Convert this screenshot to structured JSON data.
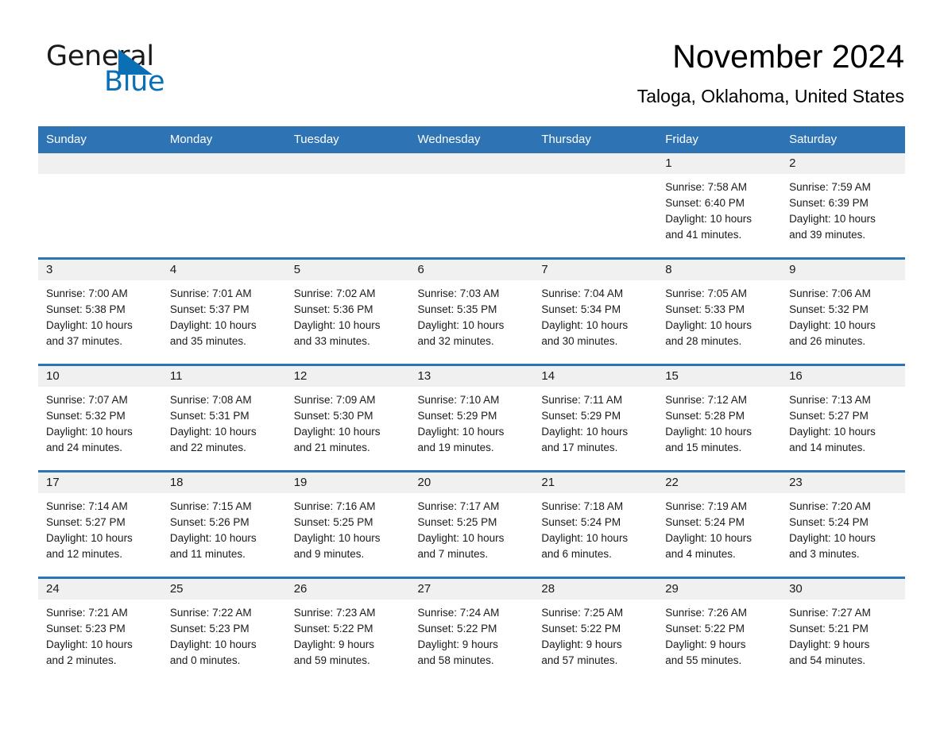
{
  "logo": {
    "word1": "General",
    "word2": "Blue",
    "triangle_color": "#0a6fb5"
  },
  "header": {
    "month_title": "November 2024",
    "location": "Taloga, Oklahoma, United States"
  },
  "theme": {
    "header_blue": "#2e74b5",
    "daynum_gray": "#f0f0f0",
    "cell_white": "#ffffff",
    "text_black": "#1a1a1a"
  },
  "calendar": {
    "weekday_headers": [
      "Sunday",
      "Monday",
      "Tuesday",
      "Wednesday",
      "Thursday",
      "Friday",
      "Saturday"
    ],
    "weeks": [
      [
        {
          "day": "",
          "lines": []
        },
        {
          "day": "",
          "lines": []
        },
        {
          "day": "",
          "lines": []
        },
        {
          "day": "",
          "lines": []
        },
        {
          "day": "",
          "lines": []
        },
        {
          "day": "1",
          "lines": [
            "Sunrise: 7:58 AM",
            "Sunset: 6:40 PM",
            "Daylight: 10 hours",
            "and 41 minutes."
          ]
        },
        {
          "day": "2",
          "lines": [
            "Sunrise: 7:59 AM",
            "Sunset: 6:39 PM",
            "Daylight: 10 hours",
            "and 39 minutes."
          ]
        }
      ],
      [
        {
          "day": "3",
          "lines": [
            "Sunrise: 7:00 AM",
            "Sunset: 5:38 PM",
            "Daylight: 10 hours",
            "and 37 minutes."
          ]
        },
        {
          "day": "4",
          "lines": [
            "Sunrise: 7:01 AM",
            "Sunset: 5:37 PM",
            "Daylight: 10 hours",
            "and 35 minutes."
          ]
        },
        {
          "day": "5",
          "lines": [
            "Sunrise: 7:02 AM",
            "Sunset: 5:36 PM",
            "Daylight: 10 hours",
            "and 33 minutes."
          ]
        },
        {
          "day": "6",
          "lines": [
            "Sunrise: 7:03 AM",
            "Sunset: 5:35 PM",
            "Daylight: 10 hours",
            "and 32 minutes."
          ]
        },
        {
          "day": "7",
          "lines": [
            "Sunrise: 7:04 AM",
            "Sunset: 5:34 PM",
            "Daylight: 10 hours",
            "and 30 minutes."
          ]
        },
        {
          "day": "8",
          "lines": [
            "Sunrise: 7:05 AM",
            "Sunset: 5:33 PM",
            "Daylight: 10 hours",
            "and 28 minutes."
          ]
        },
        {
          "day": "9",
          "lines": [
            "Sunrise: 7:06 AM",
            "Sunset: 5:32 PM",
            "Daylight: 10 hours",
            "and 26 minutes."
          ]
        }
      ],
      [
        {
          "day": "10",
          "lines": [
            "Sunrise: 7:07 AM",
            "Sunset: 5:32 PM",
            "Daylight: 10 hours",
            "and 24 minutes."
          ]
        },
        {
          "day": "11",
          "lines": [
            "Sunrise: 7:08 AM",
            "Sunset: 5:31 PM",
            "Daylight: 10 hours",
            "and 22 minutes."
          ]
        },
        {
          "day": "12",
          "lines": [
            "Sunrise: 7:09 AM",
            "Sunset: 5:30 PM",
            "Daylight: 10 hours",
            "and 21 minutes."
          ]
        },
        {
          "day": "13",
          "lines": [
            "Sunrise: 7:10 AM",
            "Sunset: 5:29 PM",
            "Daylight: 10 hours",
            "and 19 minutes."
          ]
        },
        {
          "day": "14",
          "lines": [
            "Sunrise: 7:11 AM",
            "Sunset: 5:29 PM",
            "Daylight: 10 hours",
            "and 17 minutes."
          ]
        },
        {
          "day": "15",
          "lines": [
            "Sunrise: 7:12 AM",
            "Sunset: 5:28 PM",
            "Daylight: 10 hours",
            "and 15 minutes."
          ]
        },
        {
          "day": "16",
          "lines": [
            "Sunrise: 7:13 AM",
            "Sunset: 5:27 PM",
            "Daylight: 10 hours",
            "and 14 minutes."
          ]
        }
      ],
      [
        {
          "day": "17",
          "lines": [
            "Sunrise: 7:14 AM",
            "Sunset: 5:27 PM",
            "Daylight: 10 hours",
            "and 12 minutes."
          ]
        },
        {
          "day": "18",
          "lines": [
            "Sunrise: 7:15 AM",
            "Sunset: 5:26 PM",
            "Daylight: 10 hours",
            "and 11 minutes."
          ]
        },
        {
          "day": "19",
          "lines": [
            "Sunrise: 7:16 AM",
            "Sunset: 5:25 PM",
            "Daylight: 10 hours",
            "and 9 minutes."
          ]
        },
        {
          "day": "20",
          "lines": [
            "Sunrise: 7:17 AM",
            "Sunset: 5:25 PM",
            "Daylight: 10 hours",
            "and 7 minutes."
          ]
        },
        {
          "day": "21",
          "lines": [
            "Sunrise: 7:18 AM",
            "Sunset: 5:24 PM",
            "Daylight: 10 hours",
            "and 6 minutes."
          ]
        },
        {
          "day": "22",
          "lines": [
            "Sunrise: 7:19 AM",
            "Sunset: 5:24 PM",
            "Daylight: 10 hours",
            "and 4 minutes."
          ]
        },
        {
          "day": "23",
          "lines": [
            "Sunrise: 7:20 AM",
            "Sunset: 5:24 PM",
            "Daylight: 10 hours",
            "and 3 minutes."
          ]
        }
      ],
      [
        {
          "day": "24",
          "lines": [
            "Sunrise: 7:21 AM",
            "Sunset: 5:23 PM",
            "Daylight: 10 hours",
            "and 2 minutes."
          ]
        },
        {
          "day": "25",
          "lines": [
            "Sunrise: 7:22 AM",
            "Sunset: 5:23 PM",
            "Daylight: 10 hours",
            "and 0 minutes."
          ]
        },
        {
          "day": "26",
          "lines": [
            "Sunrise: 7:23 AM",
            "Sunset: 5:22 PM",
            "Daylight: 9 hours",
            "and 59 minutes."
          ]
        },
        {
          "day": "27",
          "lines": [
            "Sunrise: 7:24 AM",
            "Sunset: 5:22 PM",
            "Daylight: 9 hours",
            "and 58 minutes."
          ]
        },
        {
          "day": "28",
          "lines": [
            "Sunrise: 7:25 AM",
            "Sunset: 5:22 PM",
            "Daylight: 9 hours",
            "and 57 minutes."
          ]
        },
        {
          "day": "29",
          "lines": [
            "Sunrise: 7:26 AM",
            "Sunset: 5:22 PM",
            "Daylight: 9 hours",
            "and 55 minutes."
          ]
        },
        {
          "day": "30",
          "lines": [
            "Sunrise: 7:27 AM",
            "Sunset: 5:21 PM",
            "Daylight: 9 hours",
            "and 54 minutes."
          ]
        }
      ]
    ]
  }
}
